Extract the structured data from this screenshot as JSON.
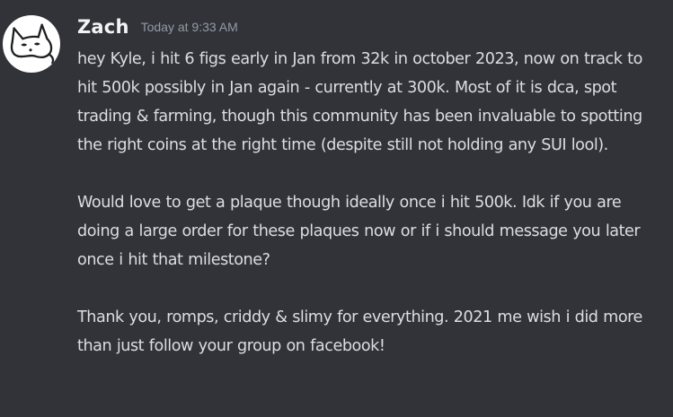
{
  "message": {
    "author": {
      "name": "Zach",
      "avatar_icon": "fox-avatar-icon"
    },
    "timestamp": "Today at 9:33 AM",
    "paragraphs": [
      "hey Kyle, i hit 6 figs early in Jan from 32k in october 2023, now on track to hit 500k possibly in Jan again - currently at 300k. Most of it is dca, spot trading & farming, though this community has been invaluable to spotting the right coins at the right time (despite still not holding any SUI lool).",
      "Would love to get a plaque though ideally once i hit 500k. Idk if you are doing a large order for these plaques now or if i should message you later once i hit that milestone?",
      "Thank you, romps, criddy & slimy for everything. 2021 me wish i did more than just follow your group on facebook!"
    ]
  },
  "colors": {
    "background": "#313338",
    "username": "#f2f3f5",
    "timestamp": "#949ba4",
    "text": "#dbdee1"
  }
}
